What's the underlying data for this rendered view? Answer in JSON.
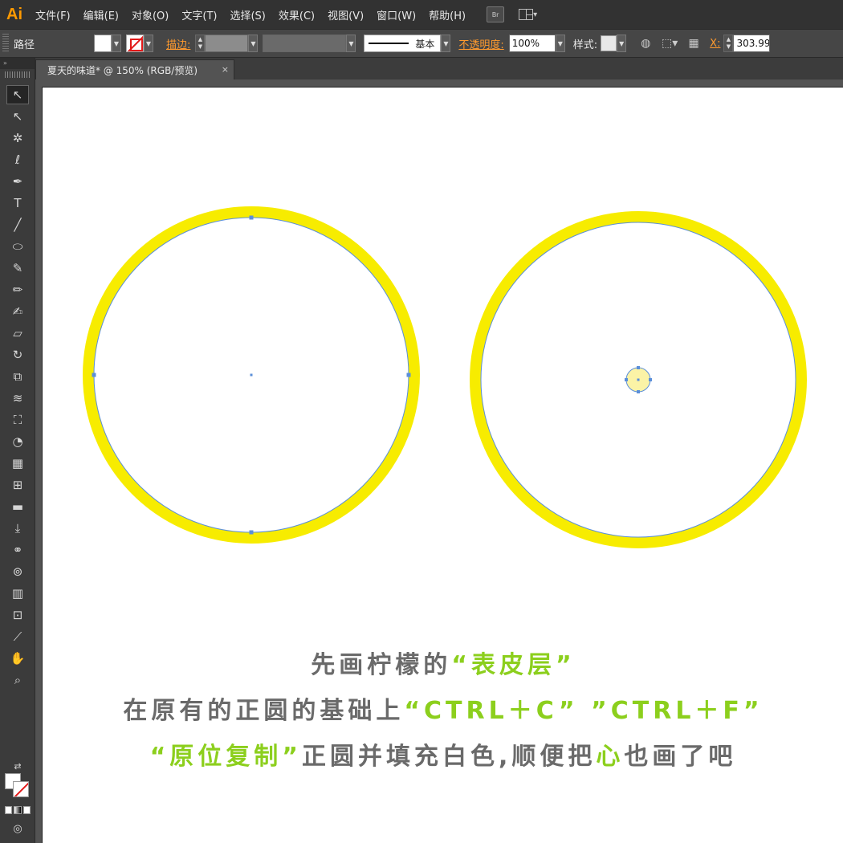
{
  "app": {
    "logo": "Ai",
    "menu": [
      "文件(F)",
      "编辑(E)",
      "对象(O)",
      "文字(T)",
      "选择(S)",
      "效果(C)",
      "视图(V)",
      "窗口(W)",
      "帮助(H)"
    ],
    "bridge_label": "Br"
  },
  "control_bar": {
    "object_type": "路径",
    "stroke_label": "描边:",
    "profile_label": "基本",
    "opacity_label": "不透明度:",
    "opacity_value": "100%",
    "style_label": "样式:",
    "x_label": "X:",
    "x_value": "303.99"
  },
  "document_tab": {
    "title": "夏天的味道* @ 150% (RGB/预览)",
    "close_glyph": "×"
  },
  "tools": [
    {
      "name": "selection-tool",
      "glyph": "↖"
    },
    {
      "name": "direct-selection-tool",
      "glyph": "↖"
    },
    {
      "name": "magic-wand-tool",
      "glyph": "✲"
    },
    {
      "name": "lasso-tool",
      "glyph": "ℓ"
    },
    {
      "name": "pen-tool",
      "glyph": "✒"
    },
    {
      "name": "type-tool",
      "glyph": "T"
    },
    {
      "name": "line-tool",
      "glyph": "╱"
    },
    {
      "name": "ellipse-tool",
      "glyph": "⬭"
    },
    {
      "name": "paintbrush-tool",
      "glyph": "✎"
    },
    {
      "name": "pencil-tool",
      "glyph": "✏"
    },
    {
      "name": "blob-brush-tool",
      "glyph": "✍"
    },
    {
      "name": "eraser-tool",
      "glyph": "▱"
    },
    {
      "name": "rotate-tool",
      "glyph": "↻"
    },
    {
      "name": "scale-tool",
      "glyph": "⧉"
    },
    {
      "name": "width-tool",
      "glyph": "≋"
    },
    {
      "name": "free-transform-tool",
      "glyph": "⛶"
    },
    {
      "name": "shape-builder-tool",
      "glyph": "◔"
    },
    {
      "name": "perspective-grid-tool",
      "glyph": "▦"
    },
    {
      "name": "mesh-tool",
      "glyph": "⊞"
    },
    {
      "name": "gradient-tool",
      "glyph": "▬"
    },
    {
      "name": "eyedropper-tool",
      "glyph": "⤓"
    },
    {
      "name": "blend-tool",
      "glyph": "⚭"
    },
    {
      "name": "symbol-sprayer-tool",
      "glyph": "⊚"
    },
    {
      "name": "column-graph-tool",
      "glyph": "▥"
    },
    {
      "name": "artboard-tool",
      "glyph": "⊡"
    },
    {
      "name": "slice-tool",
      "glyph": "⟋"
    },
    {
      "name": "hand-tool",
      "glyph": "✋"
    },
    {
      "name": "zoom-tool",
      "glyph": "⌕"
    }
  ],
  "colors": {
    "accent_orange": "#ff9a2e",
    "ring_yellow": "#f7ec00",
    "pale_yellow_fill": "#fbf3a6",
    "path_blue": "#5b8fd9",
    "caption_gray": "#6a6a6a",
    "caption_green": "#8ccf1d"
  },
  "caption": {
    "line1": [
      {
        "text": "先画柠檬的",
        "highlight": false
      },
      {
        "text": "“表皮层”",
        "highlight": true
      }
    ],
    "line2": [
      {
        "text": "在原有的正圆的基础上",
        "highlight": false
      },
      {
        "text": "“CTRL＋C” ”CTRL＋F”",
        "highlight": true
      }
    ],
    "line3": [
      {
        "text": "“原位复制”",
        "highlight": true
      },
      {
        "text": "正圆并填充白色,顺便把",
        "highlight": false
      },
      {
        "text": "心",
        "highlight": true
      },
      {
        "text": "也画了吧",
        "highlight": false
      }
    ]
  }
}
